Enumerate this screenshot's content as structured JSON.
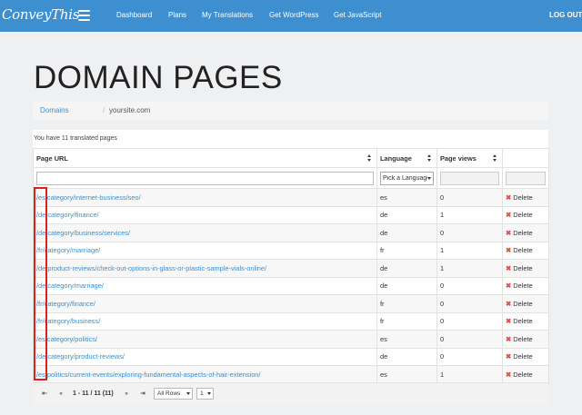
{
  "brand": {
    "logo_text": "ConveyThis"
  },
  "nav": {
    "items": [
      "Dashboard",
      "Plans",
      "My Translations",
      "Get WordPress",
      "Get JavaScript"
    ],
    "logout_label": "LOG OUT"
  },
  "page": {
    "title": "DOMAIN PAGES"
  },
  "breadcrumb": {
    "root": "Domains",
    "separator": "/",
    "current": "yoursite.com"
  },
  "summary": {
    "text": "You have 11 translated pages"
  },
  "table": {
    "columns": [
      "Page URL",
      "Language",
      "Page views",
      ""
    ],
    "language_filter_placeholder": "Pick a Language",
    "delete_label": "Delete",
    "rows": [
      {
        "url": "/es/category/internet-business/seo/",
        "lang": "es",
        "views": "0"
      },
      {
        "url": "/de/category/finance/",
        "lang": "de",
        "views": "1"
      },
      {
        "url": "/de/category/business/services/",
        "lang": "de",
        "views": "0"
      },
      {
        "url": "/fr/category/marriage/",
        "lang": "fr",
        "views": "1"
      },
      {
        "url": "/de/product-reviews/check-out-options-in-glass-or-plastic-sample-vials-online/",
        "lang": "de",
        "views": "1"
      },
      {
        "url": "/de/category/marriage/",
        "lang": "de",
        "views": "0"
      },
      {
        "url": "/fr/category/finance/",
        "lang": "fr",
        "views": "0"
      },
      {
        "url": "/fr/category/business/",
        "lang": "fr",
        "views": "0"
      },
      {
        "url": "/es/category/politics/",
        "lang": "es",
        "views": "0"
      },
      {
        "url": "/de/category/product-reviews/",
        "lang": "de",
        "views": "0"
      },
      {
        "url": "/es/politics/current-events/exploring-fundamental-aspects-of-hair-extension/",
        "lang": "es",
        "views": "1"
      }
    ]
  },
  "pager": {
    "info": "1 - 11 / 11 (11)",
    "rows_select": "All Rows",
    "page_select": "1"
  },
  "colors": {
    "topbar": "#3d8fcf",
    "link": "#3d8fcf",
    "delete_icon": "#d9534f",
    "highlight": "#e02020"
  }
}
